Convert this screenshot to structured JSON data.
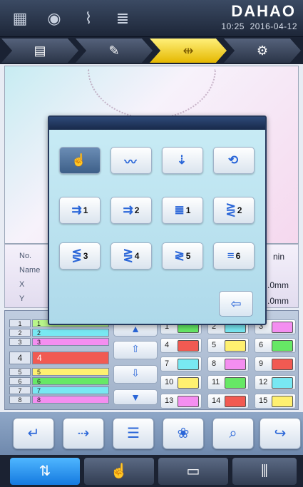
{
  "status": {
    "brand": "DAHAO",
    "time": "10:25",
    "date": "2016-04-12",
    "icons": [
      "pattern-off-icon",
      "rotate-icon",
      "thread-break-icon",
      "needle-1-icon"
    ]
  },
  "modes": [
    {
      "name": "folder-design-icon",
      "glyph": "▤"
    },
    {
      "name": "edit-design-icon",
      "glyph": "✎"
    },
    {
      "name": "frame-move-icon",
      "glyph": "⇹"
    },
    {
      "name": "needle-setup-icon",
      "glyph": "⚙"
    }
  ],
  "info": {
    "no_label": "No.",
    "name_label": "Name",
    "x_label": "X",
    "y_label": "Y",
    "min_text": "nin",
    "x_value": ".0mm",
    "y_value": ".0mm"
  },
  "popup": {
    "buttons": [
      {
        "name": "hand-wheel-button",
        "glyph": "☝",
        "num": ""
      },
      {
        "name": "zigzag-needle-button",
        "glyph": "〰",
        "num": ""
      },
      {
        "name": "needle-up-button",
        "glyph": "⇣",
        "num": ""
      },
      {
        "name": "needle-rotate-button",
        "glyph": "⟲",
        "num": ""
      },
      {
        "name": "stitch-mode-1-button",
        "glyph": "⇉",
        "num": "1"
      },
      {
        "name": "stitch-mode-2-button",
        "glyph": "⇉",
        "num": "2"
      },
      {
        "name": "needle-1-button",
        "glyph": "≣",
        "num": "1"
      },
      {
        "name": "needle-2-button",
        "glyph": "⋛",
        "num": "2"
      },
      {
        "name": "needle-3-button",
        "glyph": "⋚",
        "num": "3"
      },
      {
        "name": "needle-4-button",
        "glyph": "⋛",
        "num": "4"
      },
      {
        "name": "needle-5-button",
        "glyph": "≷",
        "num": "5"
      },
      {
        "name": "needle-6-button",
        "glyph": "≡",
        "num": "6"
      }
    ],
    "exit_glyph": "⇦"
  },
  "needles": [
    {
      "num": "1",
      "label": "1",
      "color": "#b8f58a"
    },
    {
      "num": "2",
      "label": "2",
      "color": "#78e8f2"
    },
    {
      "num": "3",
      "label": "3",
      "color": "#f48ef0"
    },
    {
      "num": "4",
      "label": "4",
      "color": "#f15a52"
    },
    {
      "num": "5",
      "label": "5",
      "color": "#fff070"
    },
    {
      "num": "6",
      "label": "6",
      "color": "#66e865"
    },
    {
      "num": "7",
      "label": "7",
      "color": "#78e8f2"
    },
    {
      "num": "8",
      "label": "8",
      "color": "#f48ef0"
    }
  ],
  "color_boxes": [
    {
      "num": "1",
      "color": "#66e865"
    },
    {
      "num": "2",
      "color": "#78e8f2"
    },
    {
      "num": "3",
      "color": "#f48ef0"
    },
    {
      "num": "4",
      "color": "#f15a52"
    },
    {
      "num": "5",
      "color": "#fff070"
    },
    {
      "num": "6",
      "color": "#66e865"
    },
    {
      "num": "7",
      "color": "#78e8f2"
    },
    {
      "num": "8",
      "color": "#f48ef0"
    },
    {
      "num": "9",
      "color": "#f15a52"
    },
    {
      "num": "10",
      "color": "#fff070"
    },
    {
      "num": "11",
      "color": "#66e865"
    },
    {
      "num": "12",
      "color": "#78e8f2"
    },
    {
      "num": "13",
      "color": "#f48ef0"
    },
    {
      "num": "14",
      "color": "#f15a52"
    },
    {
      "num": "15",
      "color": "#fff070"
    }
  ],
  "functions": [
    {
      "name": "back-button",
      "glyph": "↵"
    },
    {
      "name": "needle-assign-button",
      "glyph": "⇢"
    },
    {
      "name": "list-button",
      "glyph": "☰"
    },
    {
      "name": "design-button",
      "glyph": "❀"
    },
    {
      "name": "search-button",
      "glyph": "⌕"
    },
    {
      "name": "next-button",
      "glyph": "↪"
    }
  ],
  "nav": [
    {
      "name": "nav-needle-tab",
      "glyph": "⇅"
    },
    {
      "name": "nav-hand-tab",
      "glyph": "☝"
    },
    {
      "name": "nav-frame-tab",
      "glyph": "▭"
    },
    {
      "name": "nav-needles-tab",
      "glyph": "⫼"
    }
  ]
}
